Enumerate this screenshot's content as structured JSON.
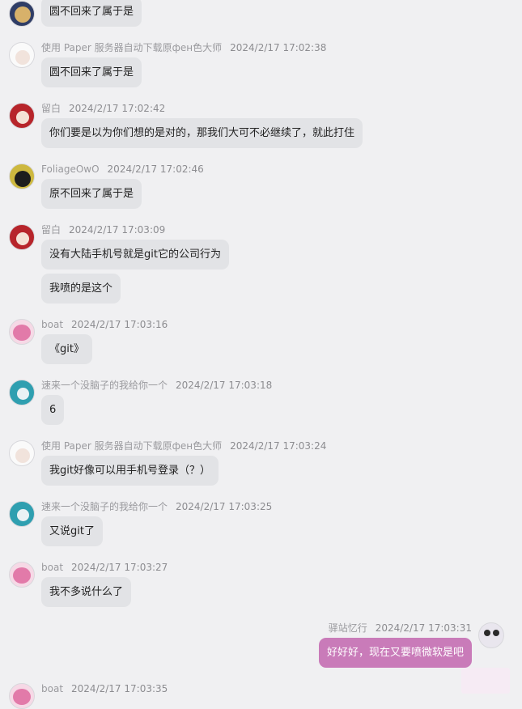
{
  "messages": [
    {
      "sender": "",
      "time": "",
      "text": "圆不回来了属于是",
      "avatar": "avatar-blue-swords",
      "color": "#3a5aa0"
    },
    {
      "sender": "使用 Paper 服务器自动下载原фен色大师",
      "time": "2024/2/17 17:02:38",
      "text": "圆不回来了属于是",
      "avatar": "avatar-white-hair-girl",
      "color": "#f3f3f5"
    },
    {
      "sender": "留白",
      "time": "2024/2/17 17:02:42",
      "text": "你们要是以为你们想的是对的，那我们大可不必继续了，就此打住",
      "avatar": "avatar-red-shrine-maiden",
      "color": "#b7252b"
    },
    {
      "sender": "FoliageOwO",
      "time": "2024/2/17 17:02:46",
      "text": "原不回来了属于是",
      "avatar": "avatar-black-cat",
      "color": "#c9b43a"
    },
    {
      "sender": "留白",
      "time": "2024/2/17 17:03:09",
      "text": "没有大陆手机号就是git它的公司行为",
      "avatar": "avatar-red-shrine-maiden",
      "color": "#b7252b"
    },
    {
      "sender": "",
      "time": "",
      "text": "我喷的是这个",
      "avatar": "",
      "color": ""
    },
    {
      "sender": "boat",
      "time": "2024/2/17 17:03:16",
      "text": "《git》",
      "avatar": "avatar-pink-girl",
      "color": "#e27aa9"
    },
    {
      "sender": "速来一个没脑子的我给你一个",
      "time": "2024/2/17 17:03:18",
      "text": "6",
      "avatar": "avatar-teal-twintails",
      "color": "#2f9fb0"
    },
    {
      "sender": "使用 Paper 服务器自动下载原фен色大师",
      "time": "2024/2/17 17:03:24",
      "text": "我git好像可以用手机号登录（？）",
      "avatar": "avatar-white-hair-girl",
      "color": "#f3f3f5"
    },
    {
      "sender": "速来一个没脑子的我给你一个",
      "time": "2024/2/17 17:03:25",
      "text": "又说git了",
      "avatar": "avatar-teal-twintails",
      "color": "#2f9fb0"
    },
    {
      "sender": "boat",
      "time": "2024/2/17 17:03:27",
      "text": "我不多说什么了",
      "avatar": "avatar-pink-girl",
      "color": "#e27aa9"
    },
    {
      "sender": "驿站忆行",
      "time": "2024/2/17 17:03:31",
      "text": "好好好，现在又要喷微软是吧",
      "avatar": "avatar-owl-face",
      "color": "#e9e6ee",
      "self": true
    },
    {
      "sender": "boat",
      "time": "2024/2/17 17:03:35",
      "text": "",
      "avatar": "avatar-pink-girl",
      "color": "#e27aa9"
    }
  ],
  "colors": {
    "background": "#f0f0f2",
    "bubble": "#e2e3e6",
    "self_bubble": "#c97bb9"
  }
}
